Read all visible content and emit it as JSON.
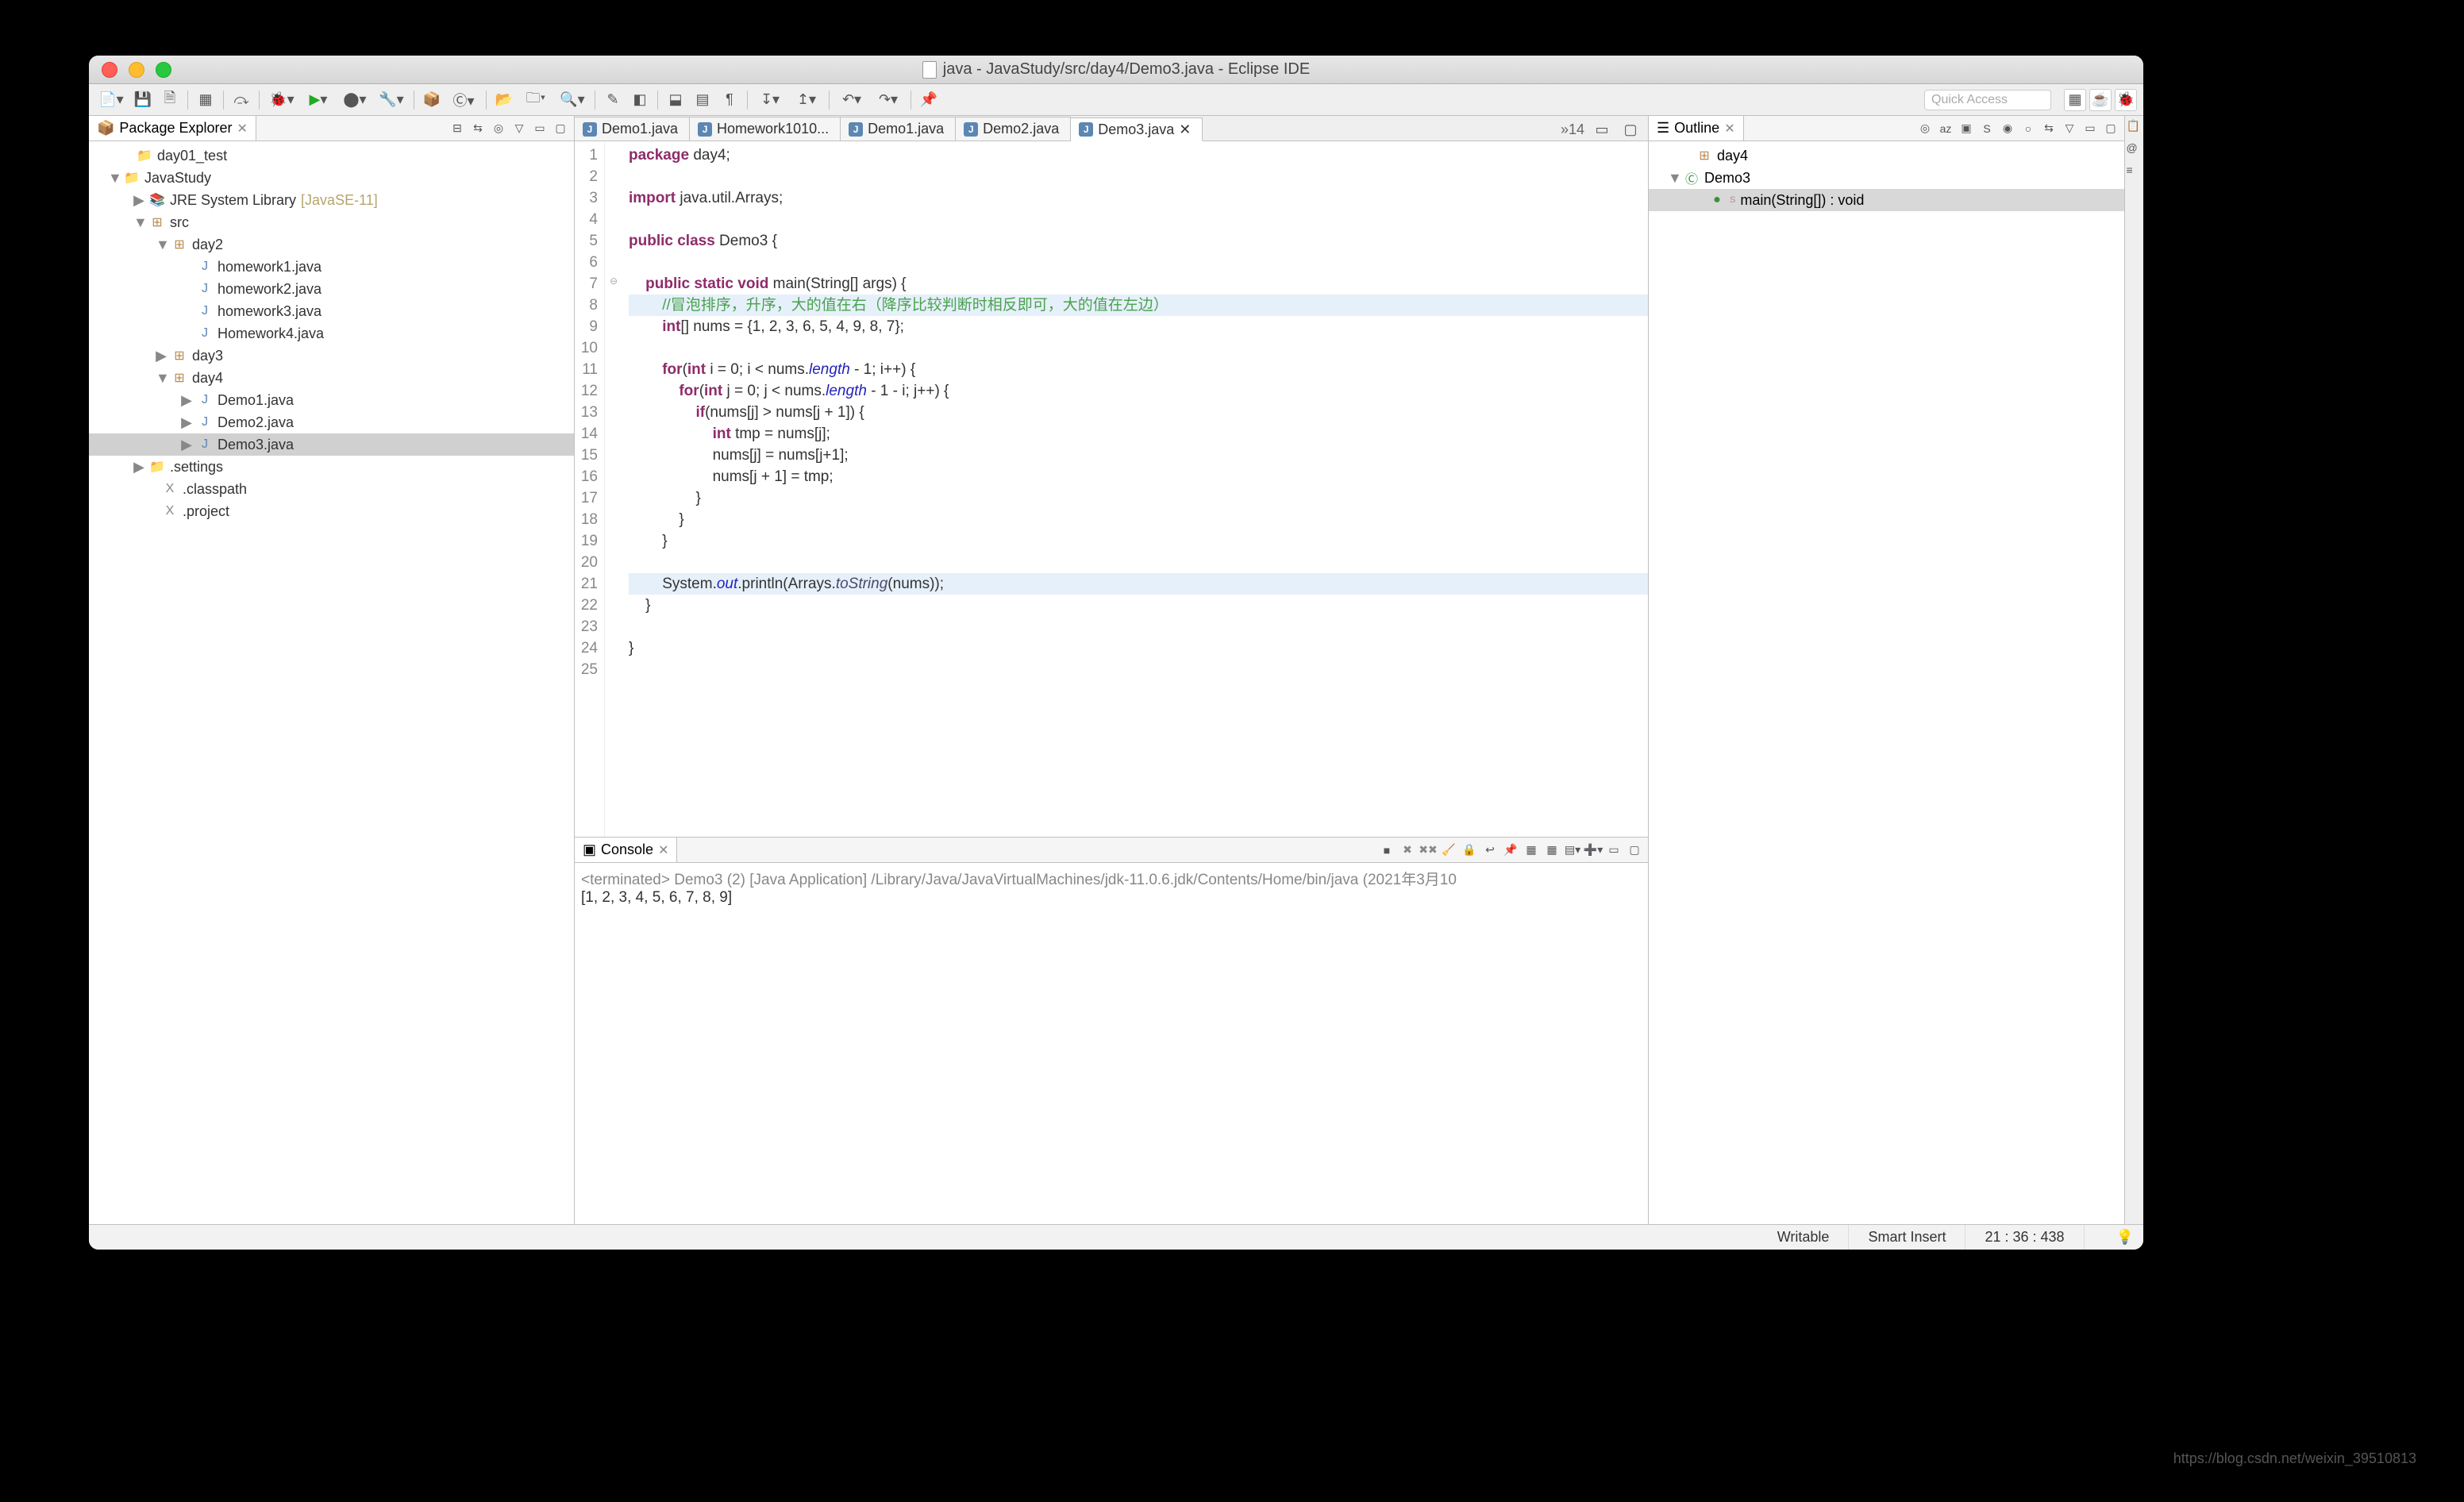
{
  "window": {
    "title": "java - JavaStudy/src/day4/Demo3.java - Eclipse IDE"
  },
  "quick_access_placeholder": "Quick Access",
  "package_explorer": {
    "title": "Package Explorer",
    "items": [
      {
        "indent": 20,
        "arrow": "",
        "icon": "folder",
        "label": "day01_test"
      },
      {
        "indent": 4,
        "arrow": "▼",
        "icon": "proj",
        "label": "JavaStudy"
      },
      {
        "indent": 36,
        "arrow": "▶",
        "icon": "lib",
        "label": "JRE System Library",
        "decorator": " [JavaSE-11]"
      },
      {
        "indent": 36,
        "arrow": "▼",
        "icon": "pkg",
        "label": "src"
      },
      {
        "indent": 64,
        "arrow": "▼",
        "icon": "pkg",
        "label": "day2"
      },
      {
        "indent": 96,
        "arrow": "",
        "icon": "jfile",
        "label": "homework1.java"
      },
      {
        "indent": 96,
        "arrow": "",
        "icon": "jfile",
        "label": "homework2.java"
      },
      {
        "indent": 96,
        "arrow": "",
        "icon": "jfile",
        "label": "homework3.java"
      },
      {
        "indent": 96,
        "arrow": "",
        "icon": "jfile",
        "label": "Homework4.java"
      },
      {
        "indent": 64,
        "arrow": "▶",
        "icon": "pkg",
        "label": "day3"
      },
      {
        "indent": 64,
        "arrow": "▼",
        "icon": "pkg",
        "label": "day4"
      },
      {
        "indent": 96,
        "arrow": "▶",
        "icon": "jfile",
        "label": "Demo1.java"
      },
      {
        "indent": 96,
        "arrow": "▶",
        "icon": "jfile",
        "label": "Demo2.java"
      },
      {
        "indent": 96,
        "arrow": "▶",
        "icon": "jfile",
        "label": "Demo3.java",
        "selected": true
      },
      {
        "indent": 36,
        "arrow": "▶",
        "icon": "folder",
        "label": ".settings"
      },
      {
        "indent": 52,
        "arrow": "",
        "icon": "txt",
        "label": ".classpath"
      },
      {
        "indent": 52,
        "arrow": "",
        "icon": "txt",
        "label": ".project"
      }
    ]
  },
  "editor_tabs": [
    {
      "label": "Demo1.java",
      "active": false
    },
    {
      "label": "Homework1010...",
      "active": false
    },
    {
      "label": "Demo1.java",
      "active": false
    },
    {
      "label": "Demo2.java",
      "active": false
    },
    {
      "label": "Demo3.java",
      "active": true
    }
  ],
  "tabs_overflow": "»14",
  "code_lines": [
    {
      "n": 1,
      "html": "<span class='kw'>package</span> day4;"
    },
    {
      "n": 2,
      "html": ""
    },
    {
      "n": 3,
      "html": "<span class='kw'>import</span> java.util.Arrays;"
    },
    {
      "n": 4,
      "html": ""
    },
    {
      "n": 5,
      "html": "<span class='kw'>public</span> <span class='kw'>class</span> Demo3 {"
    },
    {
      "n": 6,
      "html": ""
    },
    {
      "n": 7,
      "fold": "⊖",
      "html": "    <span class='kw'>public</span> <span class='kw'>static</span> <span class='kw'>void</span> main(String[] args) {"
    },
    {
      "n": 8,
      "hl": true,
      "html": "        <span class='cm'>//冒泡排序，升序，大的值在右（降序比较判断时相反即可，大的值在左边）</span>"
    },
    {
      "n": 9,
      "html": "        <span class='kw'>int</span>[] nums = {1, 2, 3, 6, 5, 4, 9, 8, 7};"
    },
    {
      "n": 10,
      "html": ""
    },
    {
      "n": 11,
      "html": "        <span class='kw'>for</span>(<span class='kw'>int</span> i = 0; i &lt; nums.<span class='field'>length</span> - 1; i++) {"
    },
    {
      "n": 12,
      "html": "            <span class='kw'>for</span>(<span class='kw'>int</span> j = 0; j &lt; nums.<span class='field'>length</span> - 1 - i; j++) {"
    },
    {
      "n": 13,
      "html": "                <span class='kw'>if</span>(nums[j] &gt; nums[j + 1]) {"
    },
    {
      "n": 14,
      "html": "                    <span class='kw'>int</span> tmp = nums[j];"
    },
    {
      "n": 15,
      "html": "                    nums[j] = nums[j+1];"
    },
    {
      "n": 16,
      "html": "                    nums[j + 1] = tmp;"
    },
    {
      "n": 17,
      "html": "                }"
    },
    {
      "n": 18,
      "html": "            }"
    },
    {
      "n": 19,
      "html": "        }"
    },
    {
      "n": 20,
      "html": ""
    },
    {
      "n": 21,
      "hl": true,
      "html": "        System.<span class='field'>out</span>.println(Arrays.<span class='method'>toString</span>(nums));"
    },
    {
      "n": 22,
      "html": "    }"
    },
    {
      "n": 23,
      "html": ""
    },
    {
      "n": 24,
      "html": "}"
    },
    {
      "n": 25,
      "html": ""
    }
  ],
  "console": {
    "title": "Console",
    "header": "<terminated> Demo3 (2) [Java Application] /Library/Java/JavaVirtualMachines/jdk-11.0.6.jdk/Contents/Home/bin/java (2021年3月10",
    "output": "[1, 2, 3, 4, 5, 6, 7, 8, 9]"
  },
  "outline": {
    "title": "Outline",
    "items": [
      {
        "indent": 20,
        "arrow": "",
        "icon": "pkg",
        "label": "day4"
      },
      {
        "indent": 4,
        "arrow": "▼",
        "icon": "class",
        "label": "Demo3"
      },
      {
        "indent": 36,
        "arrow": "",
        "icon": "method",
        "label": "main(String[]) : void",
        "selected": true,
        "sup": "S"
      }
    ]
  },
  "status": {
    "writable": "Writable",
    "insert": "Smart Insert",
    "cursor": "21 : 36 : 438"
  },
  "watermark": "https://blog.csdn.net/weixin_39510813"
}
